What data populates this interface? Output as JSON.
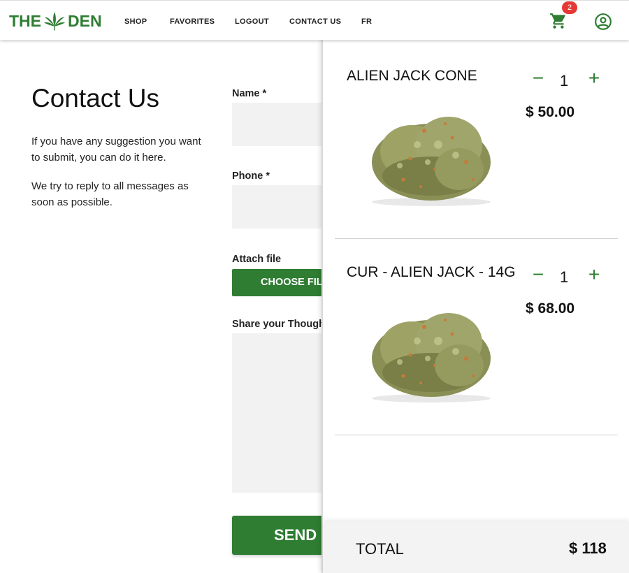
{
  "header": {
    "logo_left": "THE",
    "logo_right": "DEN",
    "nav": [
      "SHOP",
      "FAVORITES",
      "LOGOUT",
      "CONTACT US",
      "FR"
    ],
    "cart_count": "2",
    "cart_icon": "shopping-cart-icon",
    "account_icon": "account-circle-icon"
  },
  "contact": {
    "title": "Contact Us",
    "text1": "If you have any suggestion you want to submit, you can do it here.",
    "text2": "We try to reply to all messages as soon as possible.",
    "name_label": "Name *",
    "phone_label": "Phone *",
    "attach_label": "Attach file",
    "choose_file": "CHOOSE FIL",
    "thoughts_label": "Share your Though",
    "send": "SEND"
  },
  "cart": {
    "items": [
      {
        "name": "ALIEN JACK CONE",
        "qty": "1",
        "price": "$ 50.00"
      },
      {
        "name": "CUR - ALIEN JACK - 14G",
        "qty": "1",
        "price": "$ 68.00"
      }
    ],
    "total_label": "TOTAL",
    "total_value": "$ 118"
  },
  "colors": {
    "brand_green": "#2e7d32",
    "badge_red": "#e53935",
    "field_gray": "#f2f2f2"
  }
}
